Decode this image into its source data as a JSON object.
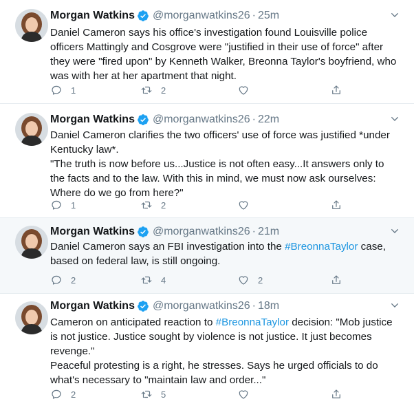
{
  "tweets": [
    {
      "name": "Morgan Watkins",
      "handle": "@morganwatkins26",
      "dot": "·",
      "time": "25m",
      "text_lines": [
        "Daniel Cameron says his office's investigation found Louisville police officers Mattingly and Cosgrove were \"justified in their use of force\" after they were \"fired upon\" by Kenneth Walker, Breonna Taylor's boyfriend, who was with her at her apartment that night."
      ],
      "replies": "1",
      "retweets": "2",
      "likes": "",
      "highlight": false
    },
    {
      "name": "Morgan Watkins",
      "handle": "@morganwatkins26",
      "dot": "·",
      "time": "22m",
      "text_lines": [
        "Daniel Cameron clarifies the two officers' use of force was justified *under Kentucky law*.",
        "\"The truth is now before us...Justice is not often easy...It answers only to the facts and to the law. With this in mind, we must now ask ourselves: Where do we go from here?\""
      ],
      "replies": "1",
      "retweets": "2",
      "likes": "",
      "highlight": false
    },
    {
      "name": "Morgan Watkins",
      "handle": "@morganwatkins26",
      "dot": "·",
      "time": "21m",
      "text_before": "Daniel Cameron says an FBI investigation into the ",
      "hashtag": "#BreonnaTaylor",
      "text_after": " case, based on federal law, is still ongoing.",
      "replies": "2",
      "retweets": "4",
      "likes": "2",
      "highlight": true
    },
    {
      "name": "Morgan Watkins",
      "handle": "@morganwatkins26",
      "dot": "·",
      "time": "18m",
      "text_before": "Cameron on anticipated reaction to ",
      "hashtag": "#BreonnaTaylor",
      "text_after": " decision: \"Mob justice is not justice. Justice sought by violence is not justice. It just becomes revenge.\"",
      "text_line2": "Peaceful protesting is a right, he stresses. Says he urged officials to do what's necessary to \"maintain law and order...\"",
      "replies": "2",
      "retweets": "5",
      "likes": "",
      "highlight": false
    }
  ],
  "colors": {
    "text": "#14171a",
    "muted": "#657786",
    "link": "#1b95e0",
    "verified": "#1da1f2",
    "divider": "#e6ecf0",
    "highlight_bg": "#f5f8fa"
  },
  "icons": {
    "reply": "reply-icon",
    "retweet": "retweet-icon",
    "like": "heart-icon",
    "share": "share-icon",
    "verified": "verified-badge-icon",
    "chevron": "chevron-down-icon"
  }
}
